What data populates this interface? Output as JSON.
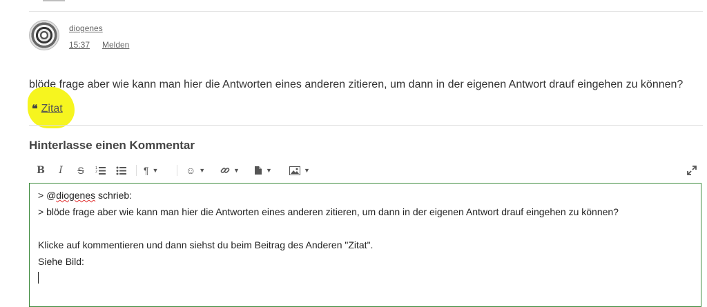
{
  "post": {
    "author": "diogenes",
    "time": "15:37",
    "report_label": "Melden",
    "text": "blöde frage aber wie kann man hier die Antworten eines anderen zitieren, um dann in der eigenen Antwort drauf eingehen zu können?",
    "quote_label": "Zitat",
    "quote_icon": "quote-icon"
  },
  "comment": {
    "heading": "Hinterlasse einen Kommentar"
  },
  "toolbar": {
    "buttons": [
      {
        "name": "bold",
        "glyph": "B"
      },
      {
        "name": "italic",
        "glyph": "I"
      },
      {
        "name": "strikethrough",
        "glyph": "S"
      },
      {
        "name": "ordered-list",
        "glyph": "1≡"
      },
      {
        "name": "unordered-list",
        "glyph": "•≡"
      },
      {
        "name": "paragraph",
        "glyph": "¶"
      },
      {
        "name": "emoji",
        "glyph": "☺"
      },
      {
        "name": "link",
        "glyph": "🔗"
      },
      {
        "name": "file",
        "glyph": "▮"
      },
      {
        "name": "image",
        "glyph": "▭"
      },
      {
        "name": "fullscreen",
        "glyph": "⤢"
      }
    ]
  },
  "editor": {
    "line1_prefix": "> ",
    "line1_mention_at": "@",
    "line1_mention_name": "diogenes",
    "line1_suffix": " schrieb:",
    "line2": "> blöde frage aber wie kann man hier die Antworten eines anderen zitieren, um dann in der eigenen Antwort drauf eingehen zu können?",
    "line3": "Klicke auf kommentieren und dann siehst du beim Beitrag des Anderen \"Zitat\".",
    "line4": "Siehe Bild:"
  },
  "colors": {
    "highlight": "#f6f51f",
    "editor_border": "#3c8a3c",
    "link": "#666666"
  }
}
